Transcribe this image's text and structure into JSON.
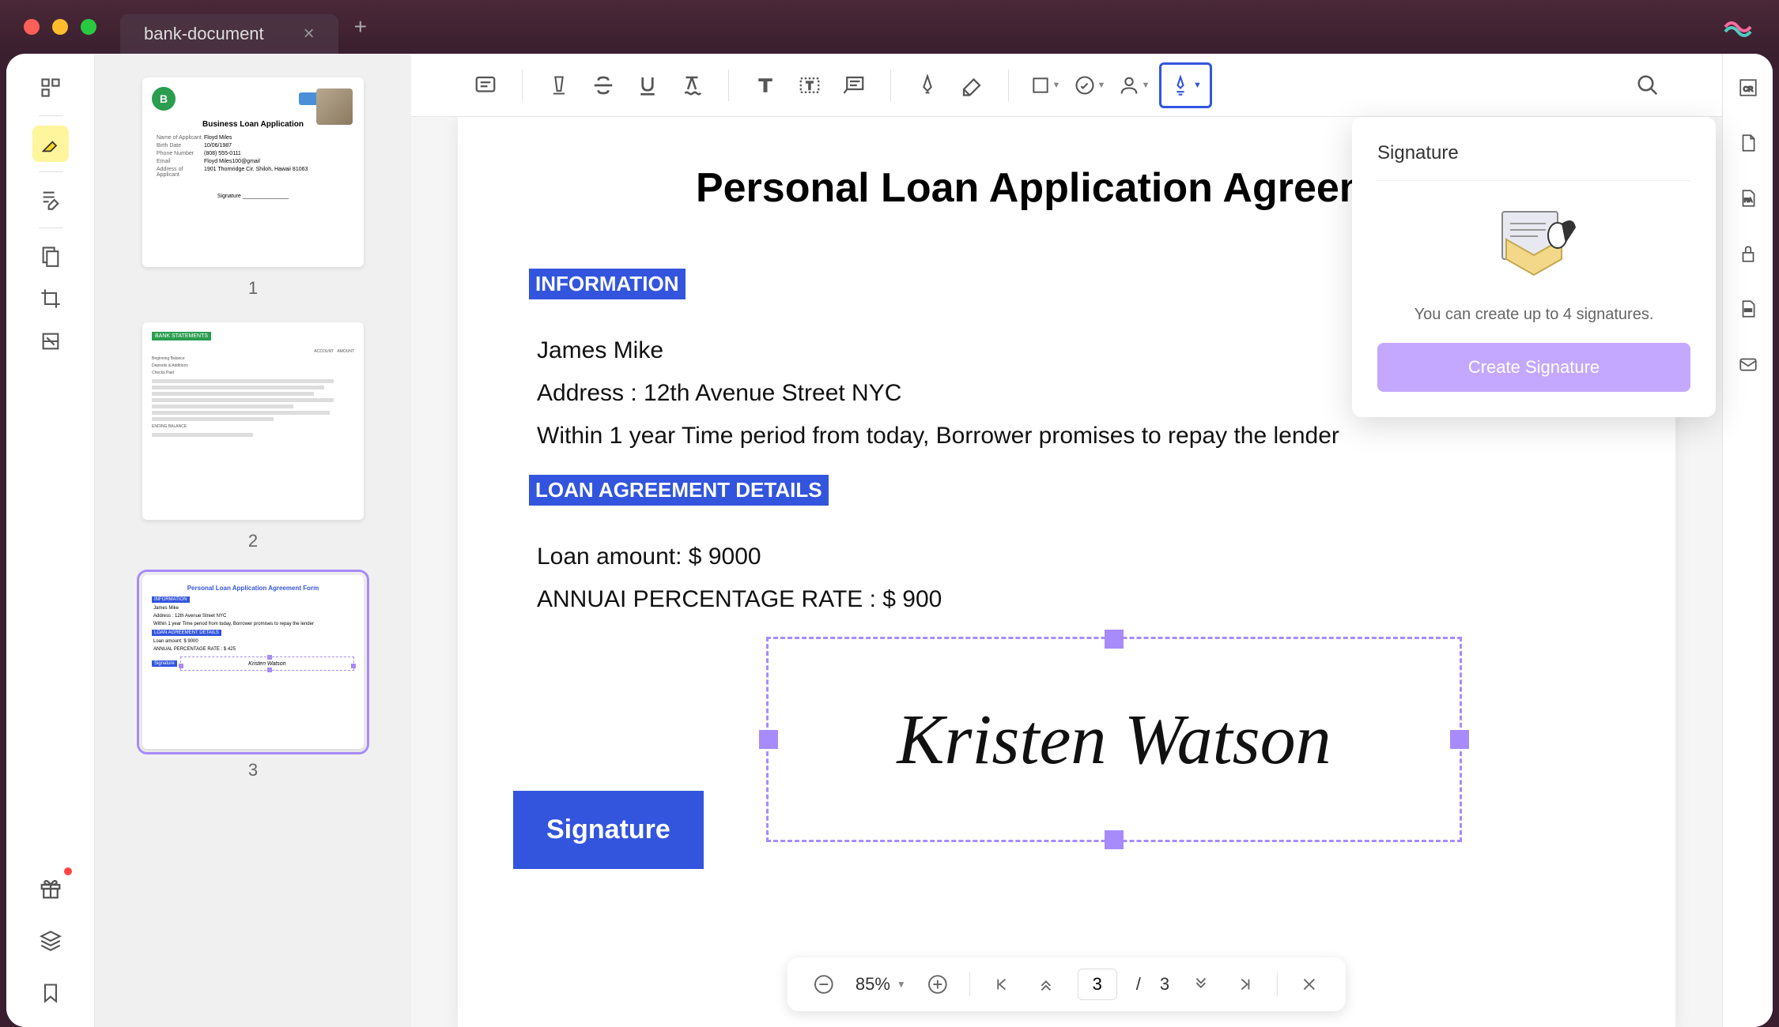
{
  "tab": {
    "title": "bank-document"
  },
  "thumbnails": [
    {
      "num": "1",
      "title": "Business Loan Application"
    },
    {
      "num": "2",
      "title": "BANK STATEMENTS"
    },
    {
      "num": "3",
      "title": "Personal Loan Application Agreement Form"
    }
  ],
  "thumb1": {
    "rows": [
      {
        "label": "Name of Applicant",
        "value": "Floyd Miles"
      },
      {
        "label": "Birth Date",
        "value": "10/06/1987"
      },
      {
        "label": "Phone Number",
        "value": "(808) 555-0111"
      },
      {
        "label": "Email",
        "value": "Floyd Miles100@gmail"
      },
      {
        "label": "Address of Applicant",
        "value": "1901 Thornridge Cir. Shiloh, Hawaii 81063"
      }
    ],
    "signature_label": "Signature"
  },
  "thumb2": {
    "lines": [
      "ACCOUNT",
      "AMOUNT",
      "Beginning Balance",
      "Deposits & Additions",
      "Checks Paid",
      "ENDING BALANCE"
    ]
  },
  "thumb3": {
    "info_label": "INFORMATION",
    "name": "James Mike",
    "address": "Address : 12th Avenue Street NYC",
    "period": "Within 1 year Time period from today, Borrower promises to repay the lender",
    "loan_label": "LOAN AGREEMENT DETAILS",
    "loan_amount": "Loan amount: $ 9000",
    "apr": "ANNUAL PERCENTAGE RATE : $ 425",
    "sig_label": "Signature",
    "sig_name": "Kristen Watson"
  },
  "doc": {
    "title": "Personal Loan Application Agreement",
    "info_label": "INFORMATION",
    "name": "James Mike",
    "address": "Address : 12th Avenue Street NYC",
    "period": "Within 1 year Time period from today, Borrower promises to repay the lender",
    "loan_label": "LOAN AGREEMENT DETAILS",
    "loan_amount": "Loan amount: $ 9000",
    "apr": "ANNUAI PERCENTAGE RATE : $ 900",
    "sig_label": "Signature",
    "sig_name": "Kristen Watson"
  },
  "popup": {
    "title": "Signature",
    "text": "You can create up to 4 signatures.",
    "button": "Create Signature"
  },
  "bottombar": {
    "zoom": "85%",
    "page": "3",
    "total": "3",
    "separator": "/"
  }
}
